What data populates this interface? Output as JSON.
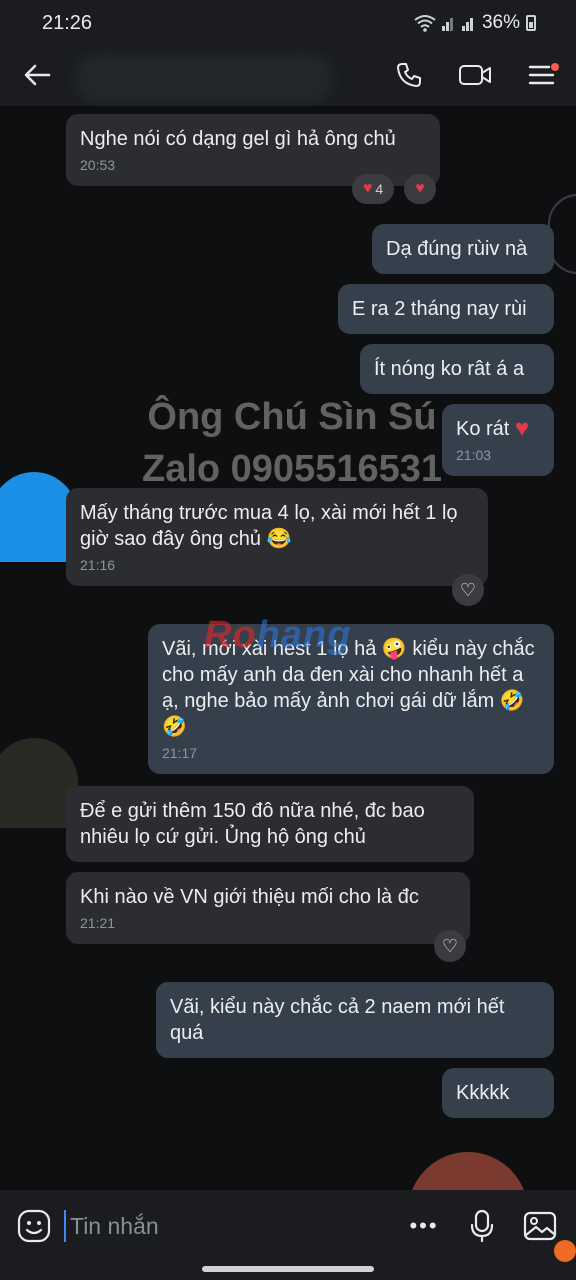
{
  "status": {
    "time": "21:26",
    "battery": "36%"
  },
  "header": {
    "icons": [
      "back-arrow-icon",
      "phone-icon",
      "video-call-icon",
      "menu-icon"
    ]
  },
  "watermark": {
    "line1": "Ông Chú Sìn Sú",
    "line2": "Zalo 0905516531",
    "logo_a": "Ro",
    "logo_b": "hang"
  },
  "messages": [
    {
      "dir": "in",
      "text": "Nghe nói có dạng gel gì hả ông chủ",
      "time": "20:53"
    },
    {
      "dir": "out",
      "text": "Dạ đúng rùiv nà"
    },
    {
      "dir": "out",
      "text": "E ra 2 tháng nay rùi"
    },
    {
      "dir": "out",
      "text": "Ít nóng ko rât á a"
    },
    {
      "dir": "out",
      "text": "Ko rát",
      "time": "21:03"
    },
    {
      "dir": "in",
      "text": "Mấy tháng trước mua 4 lọ, xài mới hết 1 lọ giờ sao đây ông chủ 😂",
      "time": "21:16"
    },
    {
      "dir": "out",
      "text": "Vãi, mới xài hest 1 lọ hả 🤪 kiểu này chắc cho mấy anh da đen xài cho nhanh hết a ạ, nghe bảo mấy ảnh chơi gái dữ lắm 🤣🤣",
      "time": "21:17"
    },
    {
      "dir": "in",
      "text": "Để e gửi thêm 150 đô nữa nhé, đc bao nhiêu lọ cứ gửi. Ủng hộ ông chủ"
    },
    {
      "dir": "in",
      "text": "Khi nào về VN giới thiệu mối cho là đc",
      "time": "21:21"
    },
    {
      "dir": "out",
      "text": "Vãi, kiểu này chắc cả 2 naem mới hết quá"
    },
    {
      "dir": "out",
      "text": "Kkkkk"
    }
  ],
  "reactions": {
    "heart_count": "4"
  },
  "composer": {
    "placeholder": "Tin nhắn",
    "more": "•••"
  },
  "colors": {
    "incoming": "#2b2d31",
    "outgoing": "#36404c",
    "heart": "#e23a4a",
    "accent": "#3d8bf2"
  }
}
